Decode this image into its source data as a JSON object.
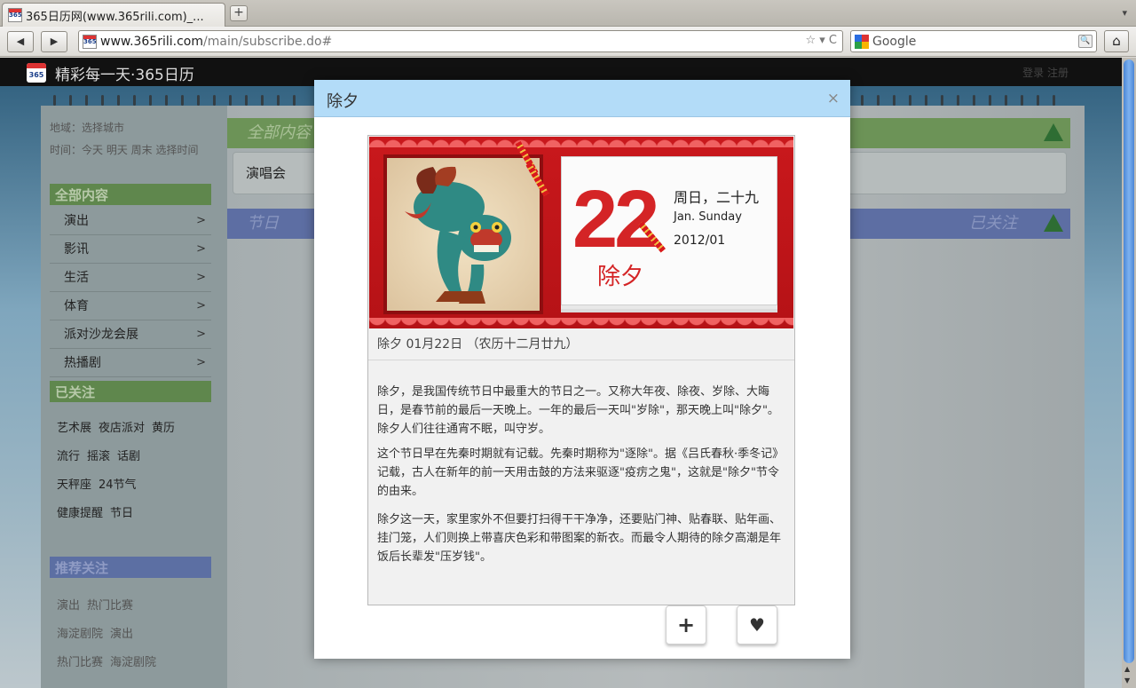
{
  "browser": {
    "tab_title": "365日历网(www.365rili.com)_...",
    "favicon_text": "365",
    "new_tab": "+",
    "tab_menu": "▾",
    "back": "◀",
    "forward": "▶",
    "url_domain": "www.365rili.com",
    "url_path": "/main/subscribe.do#",
    "url_icons": "☆ ▾ C",
    "search_engine": "Google",
    "search_go": "🔍",
    "home": "⌂"
  },
  "site": {
    "logo_text": "365",
    "name": "精彩每一天·365日历",
    "right_text": "登录 注册"
  },
  "sidebar": {
    "region": "地域：选择城市",
    "time": "时间：今天 明天 周末 选择时间",
    "all_heading": "全部内容",
    "categories": [
      {
        "label": "演出",
        "arrow": ">"
      },
      {
        "label": "影讯",
        "arrow": ">"
      },
      {
        "label": "生活",
        "arrow": ">"
      },
      {
        "label": "体育",
        "arrow": ">"
      },
      {
        "label": "派对沙龙会展",
        "arrow": ">"
      },
      {
        "label": "热播剧",
        "arrow": ">"
      }
    ],
    "followed_heading": "已关注",
    "followed_rows": [
      [
        "艺术展",
        "夜店派对",
        "黄历"
      ],
      [
        "流行",
        "摇滚",
        "话剧"
      ],
      [
        "天秤座",
        "24节气"
      ],
      [
        "健康提醒",
        "节日"
      ]
    ],
    "recommend_heading": "推荐关注",
    "recommend_rows": [
      [
        "演出",
        "热门比赛"
      ],
      [
        "海淀剧院",
        "演出"
      ],
      [
        "热门比赛",
        "海淀剧院"
      ]
    ]
  },
  "main": {
    "all_band": "全部内容",
    "concert": "演唱会",
    "holiday_band": "节日",
    "followed_label": "已关注"
  },
  "modal": {
    "title": "除夕",
    "close": "×",
    "calendar": {
      "day": "22",
      "weekday_lunar": "周日，二十九",
      "english": "Jan. Sunday",
      "year_month": "2012/01",
      "festival": "除夕"
    },
    "info_line": "除夕 01月22日 （农历十二月廿九）",
    "paragraphs": [
      "除夕，是我国传统节日中最重大的节日之一。又称大年夜、除夜、岁除、大晦日，是春节前的最后一天晚上。一年的最后一天叫\"岁除\"，那天晚上叫\"除夕\"。除夕人们往往通宵不眠，叫守岁。",
      "这个节日早在先秦时期就有记载。先秦时期称为\"逐除\"。据《吕氏春秋·季冬记》记载，古人在新年的前一天用击鼓的方法来驱逐\"疫疠之鬼\"，这就是\"除夕\"节令的由来。",
      "除夕这一天，家里家外不但要打扫得干干净净，还要贴门神、贴春联、贴年画、挂门笼，人们则换上带喜庆色彩和带图案的新衣。而最令人期待的除夕高潮是年饭后长辈发\"压岁钱\"。"
    ],
    "add_button": "+",
    "like_button": "♥"
  }
}
